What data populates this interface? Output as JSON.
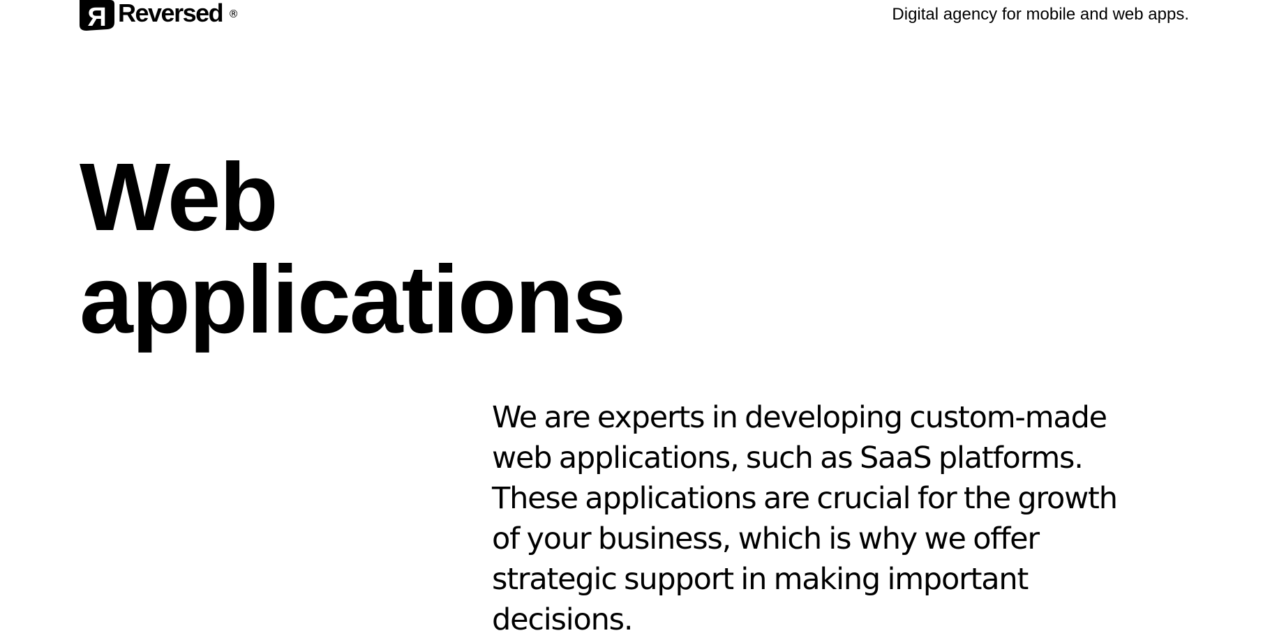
{
  "header": {
    "brand_name": "Reversed",
    "registered_mark": "®",
    "logo_icon": "reversed-r-logo",
    "tagline": "Digital agency for mobile and web apps."
  },
  "hero": {
    "title_line1": "Web",
    "title_line2": "applications"
  },
  "content": {
    "description": "We are experts in developing custom-made web applications, such as SaaS platforms. These applications are crucial for the growth of your business, which is why we offer strategic support in making important decisions."
  },
  "colors": {
    "text": "#000000",
    "background": "#ffffff"
  }
}
